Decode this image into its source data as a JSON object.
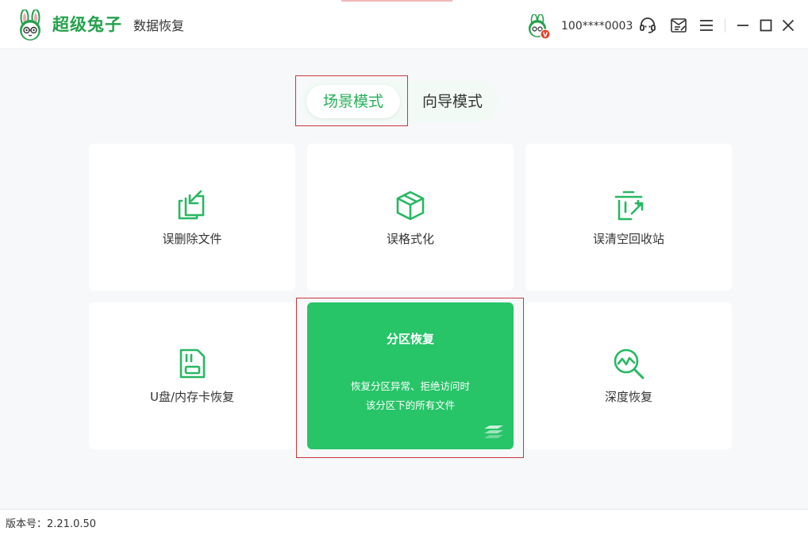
{
  "header": {
    "brand": "超级兔子",
    "subtitle": "数据恢复",
    "username": "100****0003",
    "vip_badge": "V"
  },
  "mode_tabs": [
    {
      "label": "场景模式",
      "active": true
    },
    {
      "label": "向导模式",
      "active": false
    }
  ],
  "cards": [
    {
      "label": "误删除文件",
      "icon": "file-restore-icon"
    },
    {
      "label": "误格式化",
      "icon": "cube-icon"
    },
    {
      "label": "误清空回收站",
      "icon": "recycle-bin-icon"
    },
    {
      "label": "U盘/内存卡恢复",
      "icon": "sd-card-icon"
    },
    {
      "label": "分区恢复",
      "icon": "layers-icon",
      "active": true,
      "desc_line1": "恢复分区异常、拒绝访问时",
      "desc_line2": "该分区下的所有文件"
    },
    {
      "label": "深度恢复",
      "icon": "deep-scan-icon"
    }
  ],
  "footer": {
    "version": "版本号：2.21.0.50"
  },
  "colors": {
    "accent": "#25b05a",
    "active_card": "#27c468",
    "highlight_border": "#c8373b",
    "vip_badge": "#e5402a"
  }
}
